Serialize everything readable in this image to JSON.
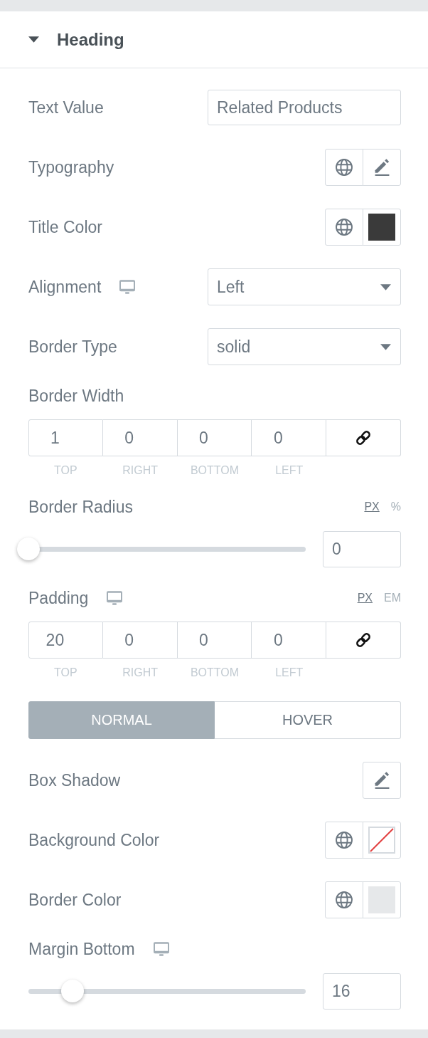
{
  "section": {
    "title": "Heading",
    "expanded": true
  },
  "controls": [
    {
      "kind": "text",
      "label": "Text Value",
      "responsive": false,
      "value": "Related Products"
    },
    {
      "kind": "popover",
      "label": "Typography",
      "responsive": false,
      "global": true
    },
    {
      "kind": "color",
      "label": "Title Color",
      "responsive": false,
      "global": true,
      "color": "#3a3a3a"
    },
    {
      "kind": "select",
      "label": "Alignment",
      "responsive": true,
      "value": "Left"
    },
    {
      "kind": "select",
      "label": "Border Type",
      "responsive": false,
      "value": "solid"
    },
    {
      "kind": "dimensions",
      "label": "Border Width",
      "responsive": false,
      "linked": true,
      "sides": [
        {
          "label": "TOP",
          "value": "1"
        },
        {
          "label": "RIGHT",
          "value": "0"
        },
        {
          "label": "BOTTOM",
          "value": "0"
        },
        {
          "label": "LEFT",
          "value": "0"
        }
      ]
    },
    {
      "kind": "slider",
      "label": "Border Radius",
      "responsive": false,
      "units": [
        {
          "label": "PX",
          "selected": true
        },
        {
          "label": "%",
          "selected": false
        }
      ],
      "level": 0,
      "value": "0"
    },
    {
      "kind": "dimensions",
      "label": "Padding",
      "responsive": true,
      "units": [
        {
          "label": "PX",
          "selected": true
        },
        {
          "label": "EM",
          "selected": false
        }
      ],
      "linked": true,
      "sides": [
        {
          "label": "TOP",
          "value": "20"
        },
        {
          "label": "RIGHT",
          "value": "0"
        },
        {
          "label": "BOTTOM",
          "value": "0"
        },
        {
          "label": "LEFT",
          "value": "0"
        }
      ]
    },
    {
      "kind": "tabs",
      "tabs": [
        {
          "label": "NORMAL",
          "selected": true
        },
        {
          "label": "HOVER",
          "selected": false
        }
      ]
    },
    {
      "kind": "popover",
      "label": "Box Shadow",
      "responsive": false,
      "global": false
    },
    {
      "kind": "color",
      "label": "Background Color",
      "responsive": false,
      "global": true
    },
    {
      "kind": "color",
      "label": "Border Color",
      "responsive": false,
      "global": true,
      "color": "#e6e8ea"
    },
    {
      "kind": "slider",
      "label": "Margin Bottom",
      "responsive": true,
      "level": 0.16,
      "value": "16"
    }
  ]
}
